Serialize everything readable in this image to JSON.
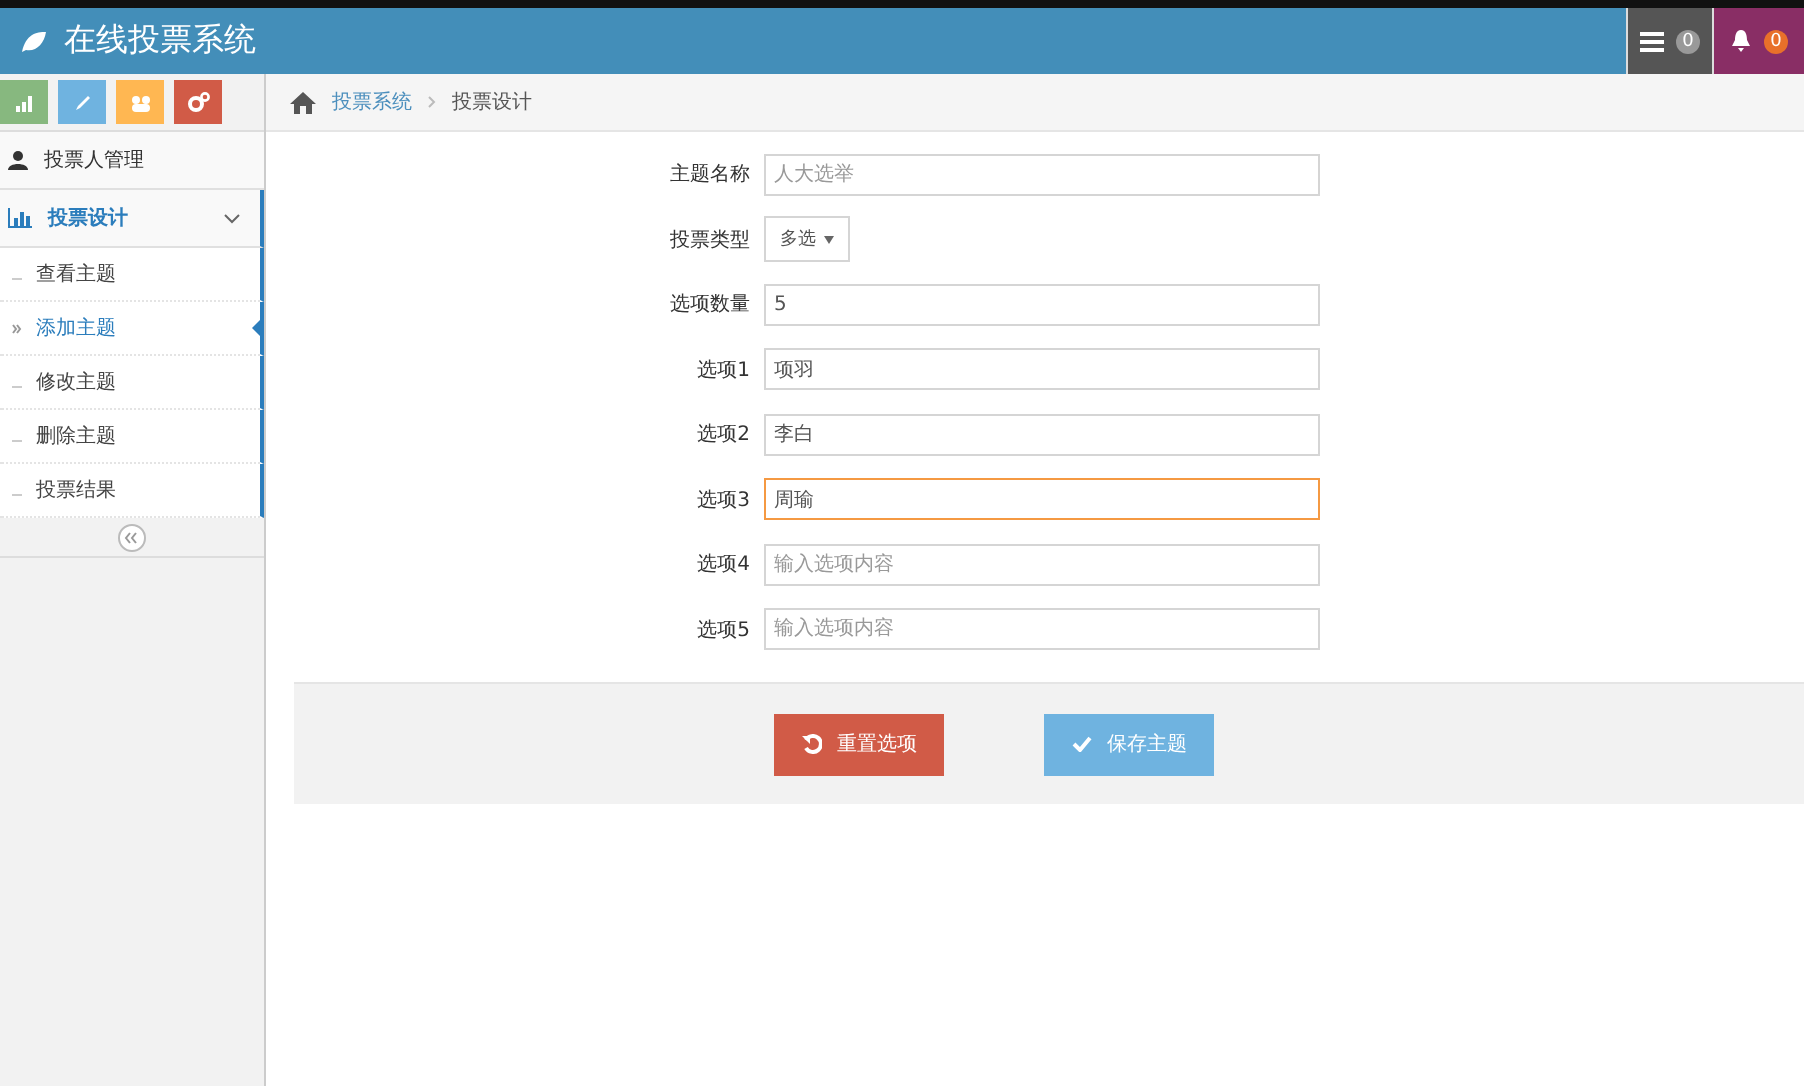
{
  "header": {
    "title": "在线投票系统",
    "badges": [
      {
        "kind": "tasks",
        "count": "0"
      },
      {
        "kind": "notifications",
        "count": "0"
      }
    ]
  },
  "shortcuts": [
    {
      "kind": "chart"
    },
    {
      "kind": "pencil"
    },
    {
      "kind": "users"
    },
    {
      "kind": "cogs"
    }
  ],
  "sidebar": {
    "items": [
      {
        "label": "投票人管理",
        "kind": "user",
        "expanded": false
      },
      {
        "label": "投票设计",
        "kind": "chart",
        "expanded": true,
        "children": [
          {
            "label": "查看主题",
            "selected": false
          },
          {
            "label": "添加主题",
            "selected": true
          },
          {
            "label": "修改主题",
            "selected": false
          },
          {
            "label": "删除主题",
            "selected": false
          },
          {
            "label": "投票结果",
            "selected": false
          }
        ]
      }
    ]
  },
  "breadcrumb": [
    {
      "label": "投票系统",
      "link": true
    },
    {
      "label": "投票设计",
      "link": false
    }
  ],
  "form": {
    "fields": [
      {
        "label": "主题名称",
        "kind": "text",
        "placeholder": "人大选举",
        "focused": false
      },
      {
        "label": "投票类型",
        "kind": "select",
        "value": "多选"
      },
      {
        "label": "选项数量",
        "kind": "text",
        "value": "5",
        "focused": false
      },
      {
        "label": "选项1",
        "kind": "text",
        "value": "项羽",
        "focused": false
      },
      {
        "label": "选项2",
        "kind": "text",
        "value": "李白",
        "focused": false
      },
      {
        "label": "选项3",
        "kind": "text",
        "value": "周瑜",
        "focused": true
      },
      {
        "label": "选项4",
        "kind": "text",
        "placeholder": "输入选项内容",
        "focused": false
      },
      {
        "label": "选项5",
        "kind": "text",
        "placeholder": "输入选项内容",
        "focused": false
      }
    ],
    "buttons": [
      {
        "label": "重置选项",
        "kind": "reset"
      },
      {
        "label": "保存主题",
        "kind": "save"
      }
    ]
  }
}
